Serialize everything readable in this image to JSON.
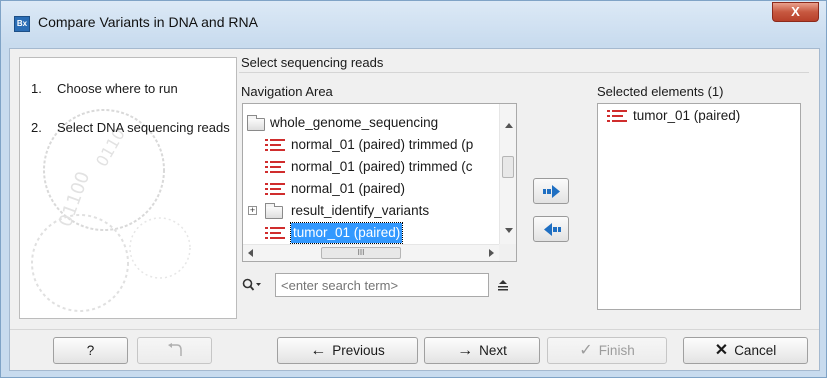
{
  "window": {
    "app_icon_text": "Bx",
    "title": "Compare Variants in DNA and RNA",
    "close_label": "X"
  },
  "steps": [
    {
      "num": "1.",
      "label": "Choose where to run"
    },
    {
      "num": "2.",
      "label": "Select DNA sequencing reads"
    }
  ],
  "main": {
    "section_title": "Select sequencing reads",
    "navigation_label": "Navigation Area",
    "selected_label": "Selected elements (1)",
    "tree_items": [
      {
        "label": "whole_genome_sequencing",
        "icon": "folder-icon"
      },
      {
        "label": "normal_01 (paired) trimmed (p",
        "icon": "sequence-list-icon"
      },
      {
        "label": "normal_01 (paired) trimmed (c",
        "icon": "sequence-list-icon"
      },
      {
        "label": "normal_01 (paired)",
        "icon": "sequence-list-icon"
      },
      {
        "label": "result_identify_variants",
        "icon": "folder-icon",
        "expander": "+"
      },
      {
        "label": "tumor_01 (paired)",
        "icon": "sequence-list-icon",
        "selected": true
      }
    ],
    "hscroll_grip": "III",
    "search": {
      "placeholder": "<enter search term>"
    },
    "selected_items": [
      {
        "label": "tumor_01 (paired)",
        "icon": "sequence-list-icon"
      }
    ],
    "colors": {
      "accent": "#3399ff",
      "arrow_blue": "#1f6fc2",
      "reads_red": "#d02d2d"
    }
  },
  "buttons": {
    "help": "?",
    "previous": "Previous",
    "next": "Next",
    "finish": "Finish",
    "cancel": "Cancel"
  }
}
